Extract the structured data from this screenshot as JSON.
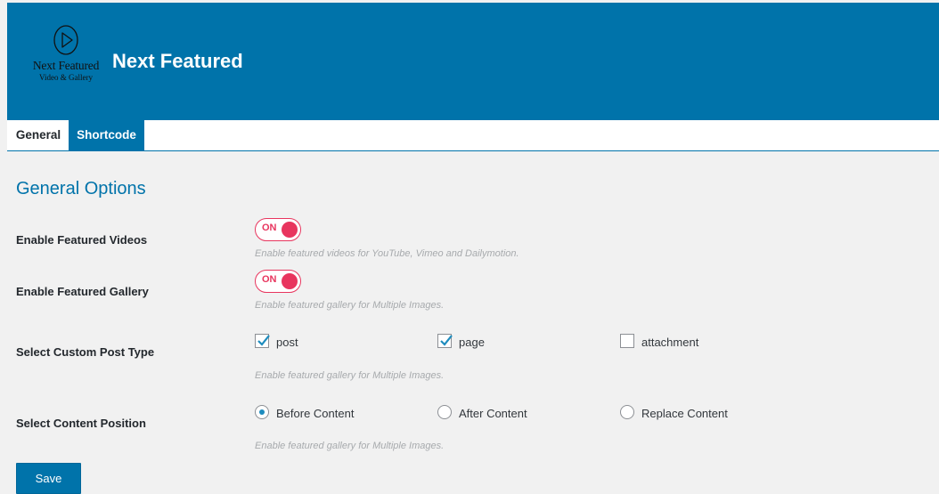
{
  "header": {
    "logo": {
      "name": "Next Featured",
      "tagline": "Video & Gallery",
      "icon": "play-circle-icon"
    },
    "title": "Next Featured"
  },
  "tabs": [
    {
      "label": "General",
      "active": true
    },
    {
      "label": "Shortcode",
      "active": false
    }
  ],
  "section_title": "General Options",
  "rows": {
    "featured_videos": {
      "label": "Enable Featured Videos",
      "toggle": "ON",
      "enabled": true,
      "hint": "Enable featured videos for YouTube, Vimeo and Dailymotion."
    },
    "featured_gallery": {
      "label": "Enable Featured Gallery",
      "toggle": "ON",
      "enabled": true,
      "hint": "Enable featured gallery for Multiple Images."
    },
    "post_type": {
      "label": "Select Custom Post Type",
      "options": [
        {
          "label": "post",
          "checked": true
        },
        {
          "label": "page",
          "checked": true
        },
        {
          "label": "attachment",
          "checked": false
        }
      ],
      "hint": "Enable featured gallery for Multiple Images."
    },
    "content_position": {
      "label": "Select Content Position",
      "options": [
        {
          "label": "Before Content",
          "selected": true
        },
        {
          "label": "After Content",
          "selected": false
        },
        {
          "label": "Replace Content",
          "selected": false
        }
      ],
      "hint": "Enable featured gallery for Multiple Images."
    }
  },
  "save_label": "Save",
  "colors": {
    "header_bg": "#0073aa",
    "toggle_accent": "#e8355e",
    "radio_dot": "#1e8cbe"
  }
}
